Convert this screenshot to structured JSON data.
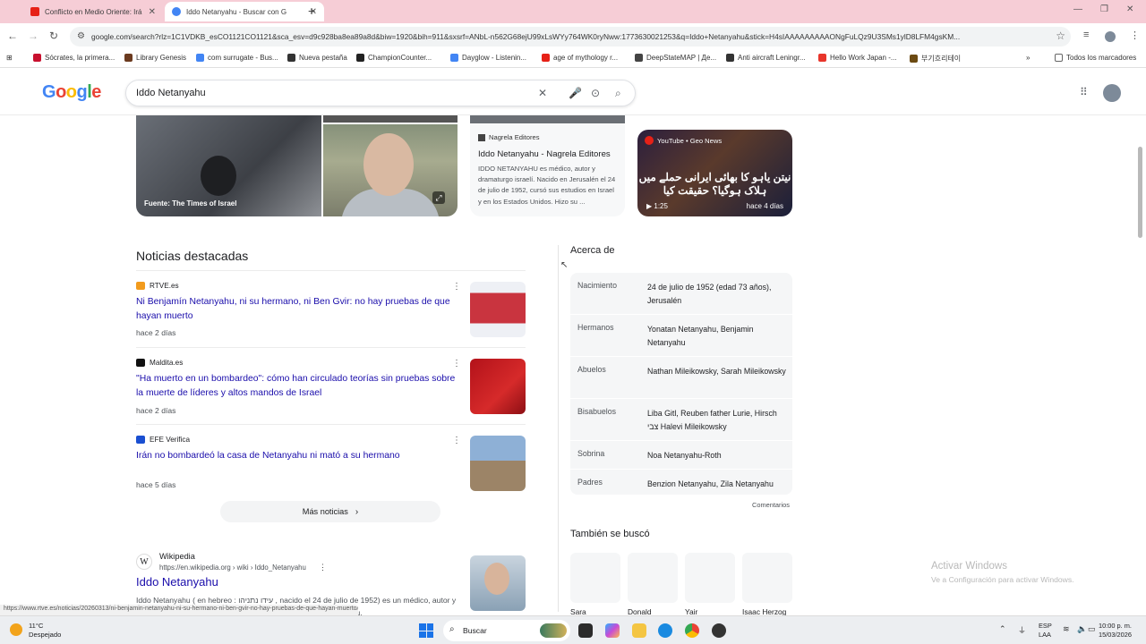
{
  "browser": {
    "tabs": [
      {
        "title": "Conflicto en Medio Oriente: Irá",
        "favicon_color": "#e62117"
      },
      {
        "title": "Iddo Netanyahu - Buscar con G",
        "favicon_color": "#4285f4"
      }
    ],
    "url": "google.com/search?rlz=1C1VDKB_esCO1121CO1121&sca_esv=d9c928ba8ea89a8d&biw=1920&bih=911&sxsrf=ANbL-n562G68ejU99xLsWYy764WK0ryNww:1773630021253&q=Iddo+Netanyahu&stick=H4sIAAAAAAAAAONgFuLQz9U3SMs1ylD8LFM4gsKM...",
    "bookmarks": [
      {
        "label": "Sócrates, la primera...",
        "color": "#c8102e"
      },
      {
        "label": "Library Genesis",
        "color": "#6b3a1f"
      },
      {
        "label": "com surrugate - Bus...",
        "color": "#4285f4"
      },
      {
        "label": "Nueva pestaña",
        "color": "#333333"
      },
      {
        "label": "ChampionCounter...",
        "color": "#222222"
      },
      {
        "label": "Dayglow - Listenin...",
        "color": "#4285f4"
      },
      {
        "label": "age of mythology r...",
        "color": "#e62117"
      },
      {
        "label": "DeepStateMAP | Де...",
        "color": "#444444"
      },
      {
        "label": "Anti aircraft Leningr...",
        "color": "#333333"
      },
      {
        "label": "Hello Work Japan -...",
        "color": "#e8352b"
      },
      {
        "label": "부기흐리테이",
        "color": "#6b4a12"
      }
    ],
    "bookmarks_more": "»",
    "all_bookmarks": "Todos los marcadores"
  },
  "google": {
    "logo": "Google",
    "query": "Iddo Netanyahu"
  },
  "media": {
    "image_caption": "Fuente: The Times of Israel",
    "nagrela": {
      "source": "Nagrela Editores",
      "title": "Iddo Netanyahu - Nagrela Editores",
      "snippet": "IDDO NETANYAHU es médico, autor y dramaturgo israelí. Nacido en Jerusalén el 24 de julio de 1952, cursó sus estudios en Israel y en los Estados Unidos. Hizo su ..."
    },
    "video": {
      "source": "YouTube • Geo News",
      "overlay_text": "نیتن یاہو کا بھائی ایرانی حملے میں ہلاک ہوگیا؟ حقیقت کیا",
      "duration": "1:25",
      "age": "hace 4 días"
    }
  },
  "news": {
    "heading": "Noticias destacadas",
    "items": [
      {
        "source": "RTVE.es",
        "title": "Ni Benjamín Netanyahu, ni su hermano, ni Ben Gvir: no hay pruebas de que hayan muerto",
        "age": "hace 2 días",
        "thumb_color": "#c9343f",
        "icon_color": "#f29b1d"
      },
      {
        "source": "Maldita.es",
        "title": "\"Ha muerto en un bombardeo\": cómo han circulado teorías sin pruebas sobre la muerte de líderes y altos mandos de Israel",
        "age": "hace 2 días",
        "thumb_color": "#b3121a",
        "icon_color": "#111111"
      },
      {
        "source": "EFE Verifica",
        "title": "Irán no bombardeó la casa de Netanyahu ni mató a su hermano",
        "age": "hace 5 días",
        "thumb_color": "#6f8fb5",
        "icon_color": "#1a4fd1"
      }
    ],
    "more_label": "Más noticias",
    "more_chevron": "›"
  },
  "wiki": {
    "name": "Wikipedia",
    "url": "https://en.wikipedia.org › wiki › Iddo_Netanyahu",
    "title": "Iddo Netanyahu",
    "snippet": "Iddo Netanyahu ( en hebreo : עידו נתניהו , nacido el 24 de julio de 1952) es un médico, autor y dramaturgo israelí. Es el hermano menor de Benjamin Netanyahu."
  },
  "about": {
    "heading": "Acerca de",
    "facts": [
      {
        "key": "Nacimiento",
        "value": "24 de julio de 1952 (edad 73 años), Jerusalén"
      },
      {
        "key": "Hermanos",
        "value": "Yonatan Netanyahu, Benjamin Netanyahu"
      },
      {
        "key": "Abuelos",
        "value": "Nathan Mileikowsky, Sarah Mileikowsky"
      },
      {
        "key": "Bisabuelos",
        "value": "Liba Gitl, Reuben father Lurie, Hirsch צבי Halevi Mileikowsky"
      },
      {
        "key": "Sobrina",
        "value": "Noa Netanyahu-Roth"
      },
      {
        "key": "Padres",
        "value": "Benzion Netanyahu, Zila Netanyahu"
      }
    ],
    "comments": "Comentarios",
    "also_heading": "También se buscó",
    "also": [
      "Sara",
      "Donald",
      "Yair",
      "Isaac Herzog"
    ]
  },
  "windows": {
    "activate_title": "Activar Windows",
    "activate_sub": "Ve a Configuración para activar Windows.",
    "status_url": "https://www.rtve.es/noticias/20260313/ni-benjamin-netanyahu-ni-su-hermano-ni-ben-gvir-no-hay-pruebas-de-que-hayan-muerto/16980002.shtml",
    "weather_temp": "11°C",
    "weather_desc": "Despejado",
    "search_label": "Buscar",
    "lang1": "ESP",
    "lang2": "LAA",
    "time": "10:00 p. m.",
    "date": "15/03/2026"
  }
}
